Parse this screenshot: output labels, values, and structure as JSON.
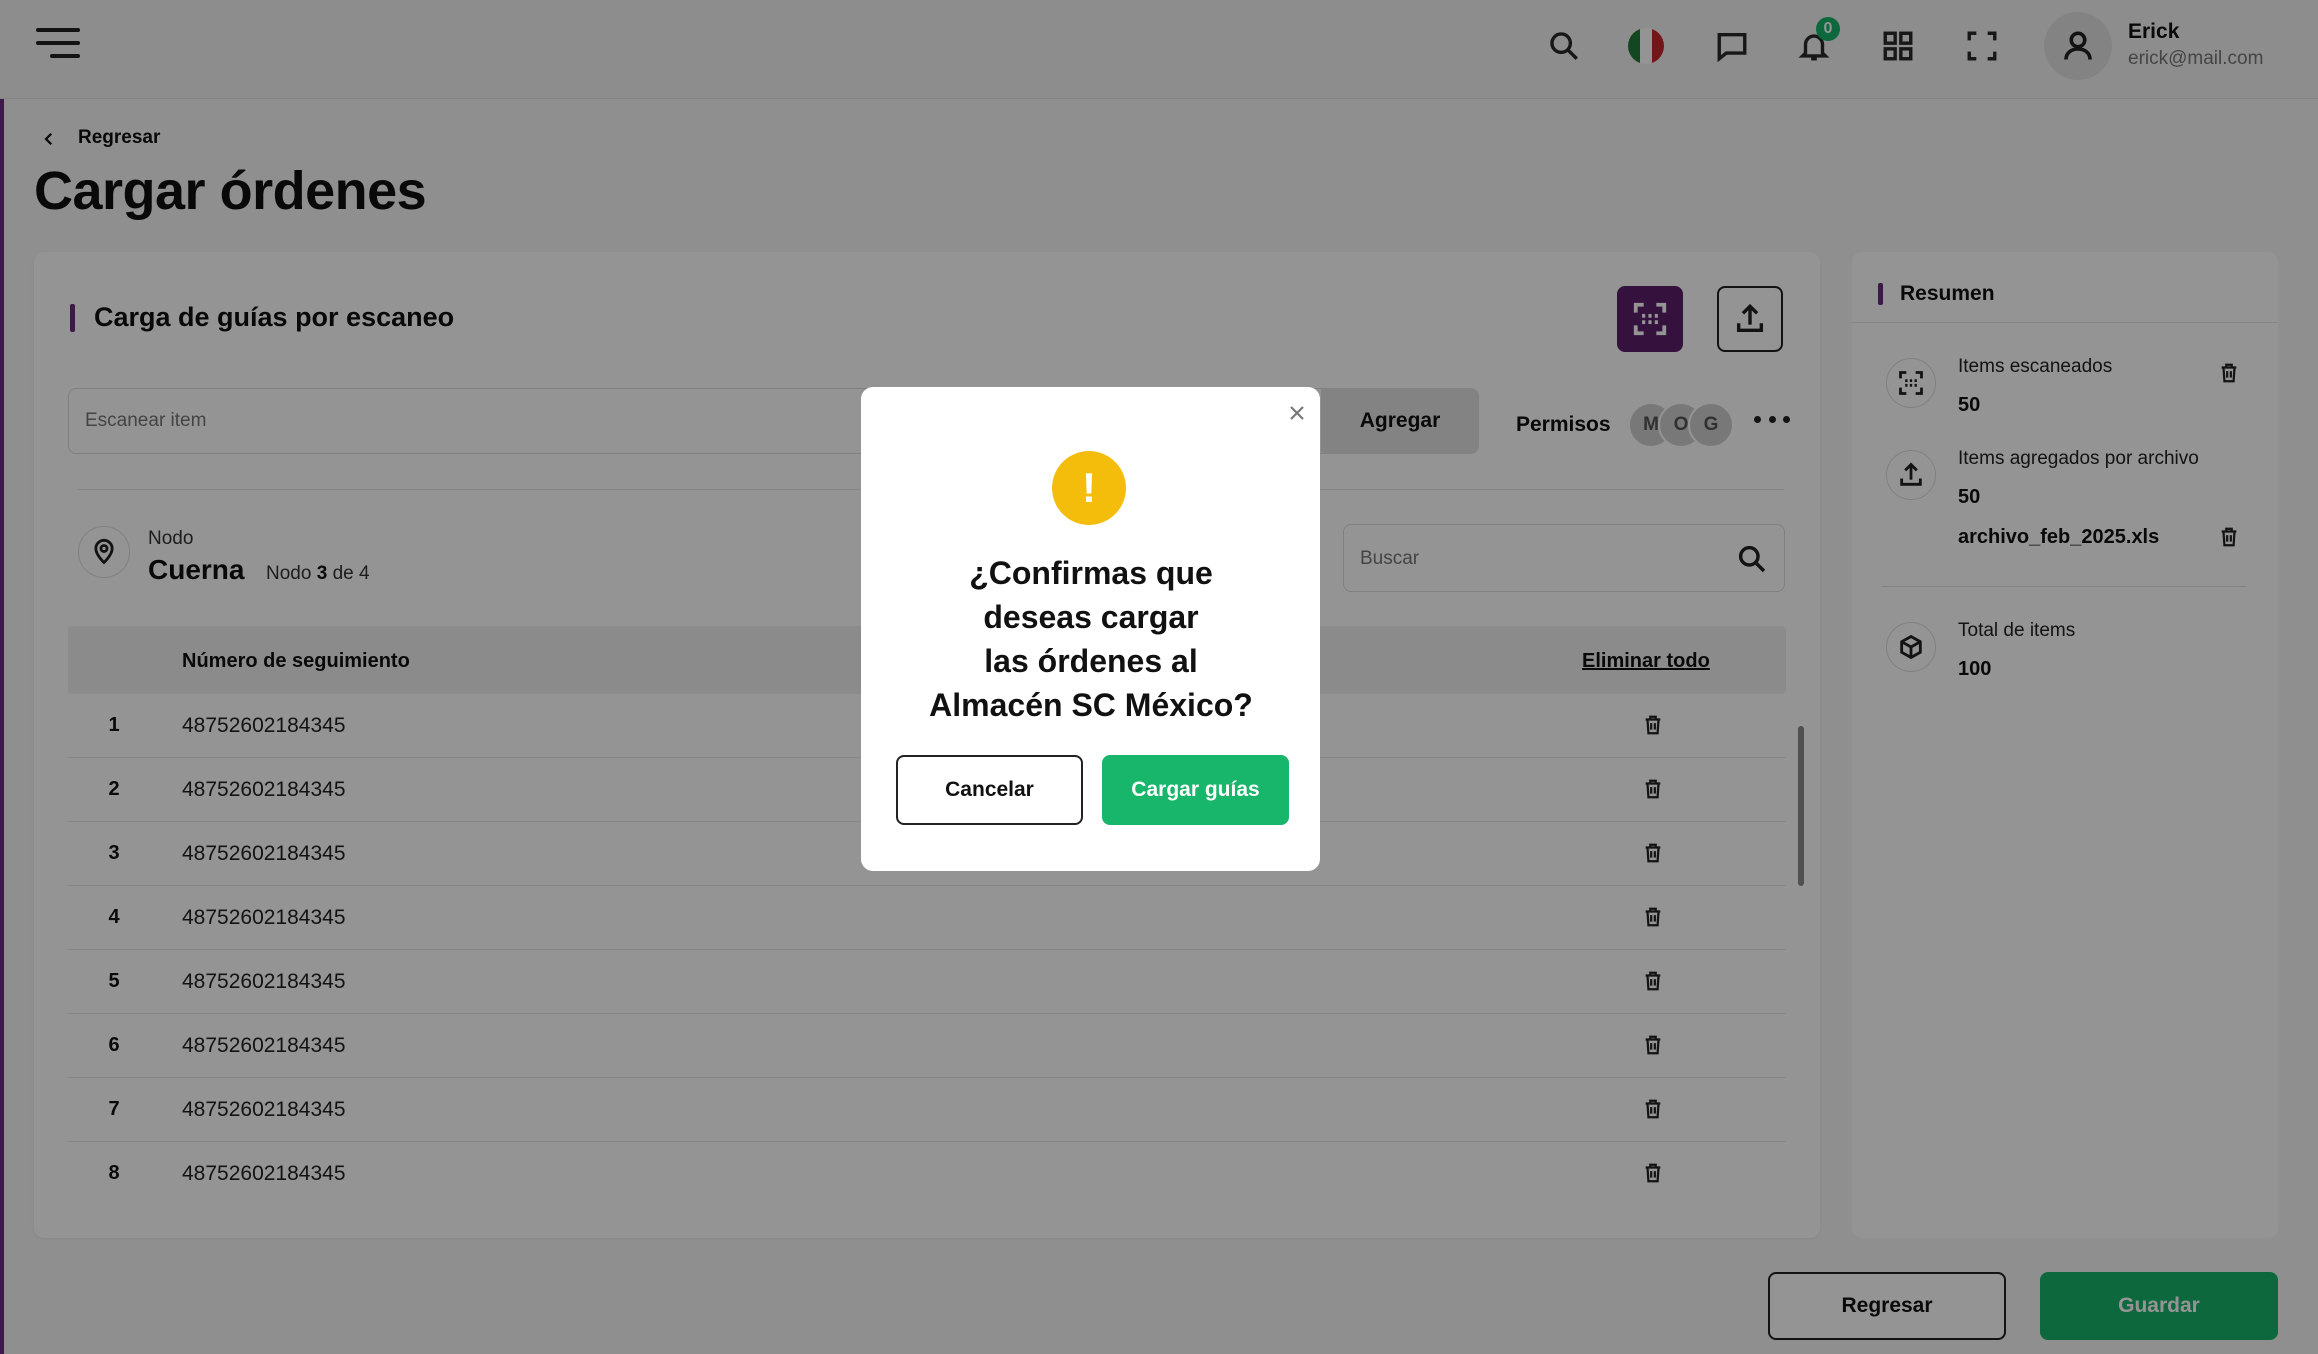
{
  "header": {
    "menu_icon": "hamburger-menu-icon",
    "notifications_count": "0",
    "user": {
      "name": "Erick",
      "email": "erick@mail.com"
    },
    "flag_colors": [
      "#1f7a3a",
      "#ffffff",
      "#c7262b"
    ]
  },
  "breadcrumb": {
    "back_label": "Regresar"
  },
  "page": {
    "title": "Cargar órdenes"
  },
  "scan_section": {
    "title": "Carga de guías por escaneo",
    "scan_input_placeholder": "Escanear item",
    "add_label": "Agregar",
    "permissions_label": "Permisos",
    "permission_avatars": [
      "M",
      "O",
      "G"
    ]
  },
  "node": {
    "label": "Nodo",
    "name": "Cuerna",
    "count_prefix": "Nodo",
    "current": "3",
    "count_suffix": "de 4"
  },
  "search": {
    "placeholder": "Buscar"
  },
  "table": {
    "column_number": "Número de seguimiento",
    "delete_all_label": "Eliminar todo",
    "rows": [
      {
        "index": "1",
        "tracking": "48752602184345"
      },
      {
        "index": "2",
        "tracking": "48752602184345"
      },
      {
        "index": "3",
        "tracking": "48752602184345"
      },
      {
        "index": "4",
        "tracking": "48752602184345"
      },
      {
        "index": "5",
        "tracking": "48752602184345"
      },
      {
        "index": "6",
        "tracking": "48752602184345"
      },
      {
        "index": "7",
        "tracking": "48752602184345"
      },
      {
        "index": "8",
        "tracking": "48752602184345"
      }
    ]
  },
  "summary": {
    "title": "Resumen",
    "scanned_label": "Items escaneados",
    "scanned_value": "50",
    "file_label": "Items agregados por archivo",
    "file_value": "50",
    "file_name": "archivo_feb_2025.xls",
    "total_label": "Total de items",
    "total_value": "100"
  },
  "footer": {
    "back_label": "Regresar",
    "save_label": "Guardar"
  },
  "modal": {
    "line1": "¿Confirmas que",
    "line2": "deseas cargar",
    "line3": "las órdenes al",
    "line4": "Almacén SC México?",
    "cancel_label": "Cancelar",
    "confirm_label": "Cargar guías",
    "warning_symbol": "!"
  },
  "colors": {
    "brand_purple": "#5a1f6a",
    "accent_green": "#17b66a",
    "warning_yellow": "#f5bd0b"
  }
}
